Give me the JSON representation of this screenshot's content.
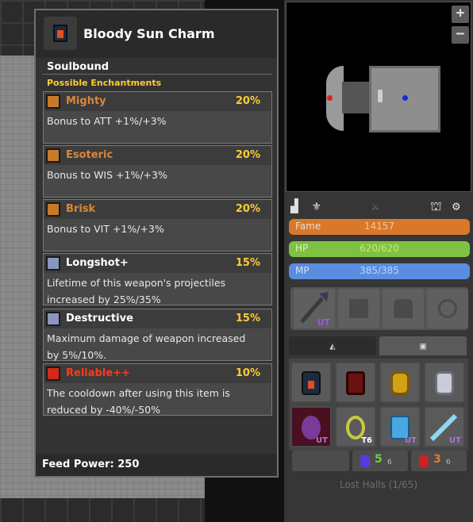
{
  "tooltip": {
    "title": "Bloody Sun Charm",
    "soulbound": "Soulbound",
    "possible_label": "Possible Enchantments",
    "enchantments": [
      {
        "name": "Mighty",
        "percent": "20%",
        "desc1": "Bonus to ATT +1%/+3%",
        "desc2": "",
        "color": "#d8883a",
        "icon": "orange-rune-icon"
      },
      {
        "name": "Esoteric",
        "percent": "20%",
        "desc1": "Bonus to WIS +1%/+3%",
        "desc2": "",
        "color": "#d8883a",
        "icon": "orange-rune-icon"
      },
      {
        "name": "Brisk",
        "percent": "20%",
        "desc1": "Bonus to VIT +1%/+3%",
        "desc2": "",
        "color": "#d8883a",
        "icon": "orange-rune-icon"
      },
      {
        "name": "Longshot+",
        "percent": "15%",
        "desc1": "Lifetime of this weapon's projectiles",
        "desc2": "increased by 25%/35%",
        "color": "#ffffff",
        "icon": "blue-rune-icon"
      },
      {
        "name": "Destructive",
        "percent": "15%",
        "desc1": "Maximum damage of weapon increased",
        "desc2": "by 5%/10%.",
        "color": "#ffffff",
        "icon": "blue-rune-icon"
      },
      {
        "name": "Reliable++",
        "percent": "10%",
        "desc1": "The cooldown after using this item is",
        "desc2": "reduced by -40%/-50%",
        "color": "#ff3a1c",
        "icon": "red-rune-icon"
      }
    ],
    "feed_power": "Feed Power: 250"
  },
  "minimap": {
    "zoom_in": "+",
    "zoom_out": "−"
  },
  "stats": {
    "fame_label": "Fame",
    "fame_value": "14157",
    "hp_label": "HP",
    "hp_value": "620/620",
    "mp_label": "MP",
    "mp_value": "385/385"
  },
  "colors": {
    "fame": "#d9782a",
    "hp": "#7ec242",
    "mp": "#5a8de0"
  },
  "equipment": {
    "weapon_tag": "UT"
  },
  "inventory": {
    "slot5_tag": "UT",
    "slot6_tag": "T6",
    "slot7_tag": "UT",
    "slot8_tag": "UT"
  },
  "potions": {
    "blue_count": "5",
    "blue_max": "6",
    "red_count": "3",
    "red_max": "6"
  },
  "location": "Lost Halls (1/65)"
}
